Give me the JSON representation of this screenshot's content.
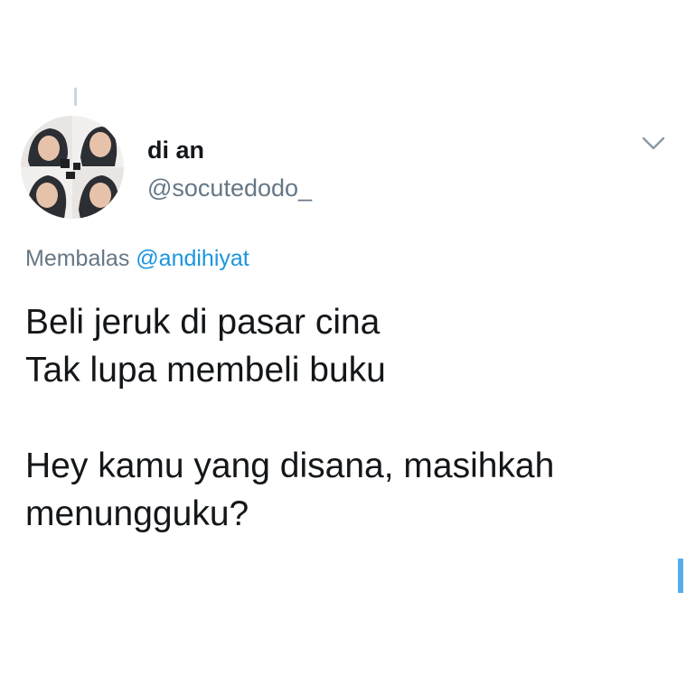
{
  "tweet": {
    "display_name": "di an",
    "handle": "@socutedodo_",
    "reply_prefix": "Membalas",
    "reply_to": "@andihiyat",
    "lines": [
      "Beli jeruk di pasar cina",
      "Tak lupa membeli buku",
      "",
      "Hey kamu yang disana, masihkah",
      "menungguku?"
    ]
  },
  "icons": {
    "caret": "chevron-down-icon",
    "avatar": "profile-photo"
  },
  "colors": {
    "text": "#14171a",
    "secondary": "#657786",
    "link": "#1b95e0",
    "thread_line": "#ccd6dd",
    "scroll_indicator": "#55aeea"
  }
}
